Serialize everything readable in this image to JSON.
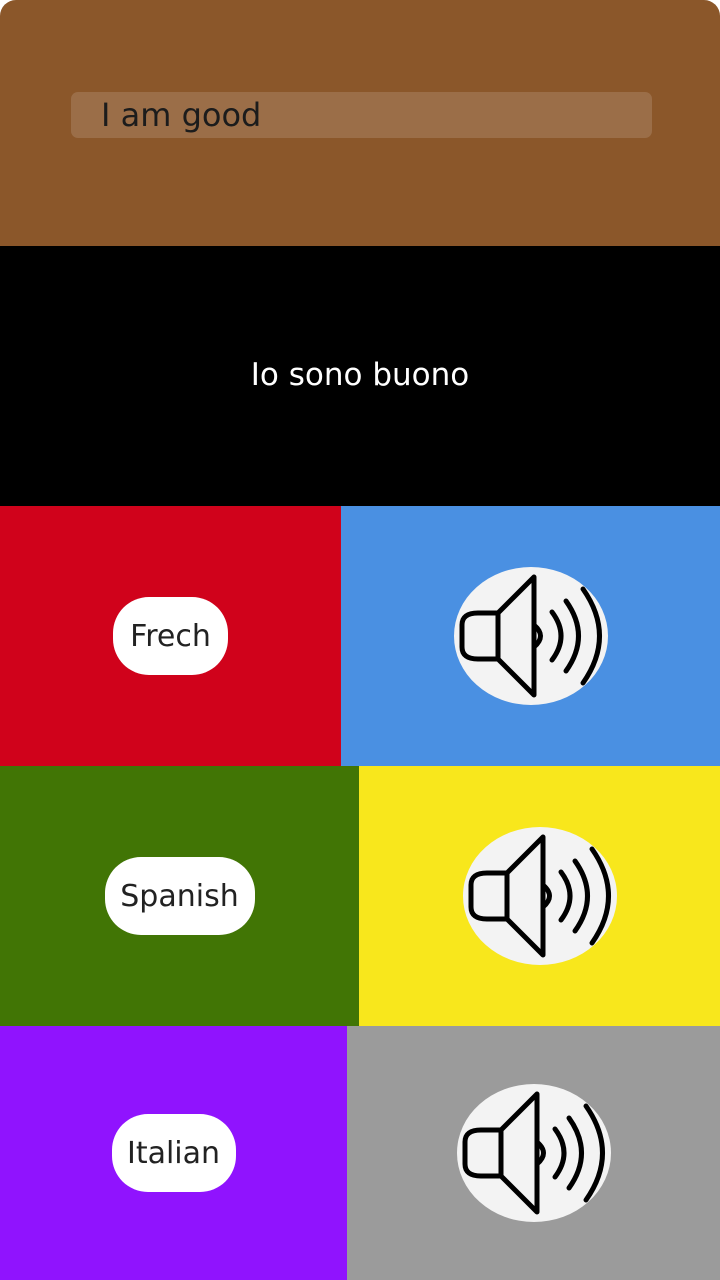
{
  "input": {
    "value": "I am good"
  },
  "translation": {
    "text": "Io sono buono"
  },
  "rows": [
    {
      "label": "Frech",
      "left_color": "#d0021b",
      "right_color": "#4a90e2",
      "icon": "speaker-icon"
    },
    {
      "label": "Spanish",
      "left_color": "#417505",
      "right_color": "#f8e71c",
      "icon": "speaker-icon"
    },
    {
      "label": "Italian",
      "left_color": "#9013fe",
      "right_color": "#9b9b9b",
      "icon": "speaker-icon"
    }
  ],
  "colors": {
    "top_panel": "#8b572a",
    "translation_panel": "#000000"
  }
}
